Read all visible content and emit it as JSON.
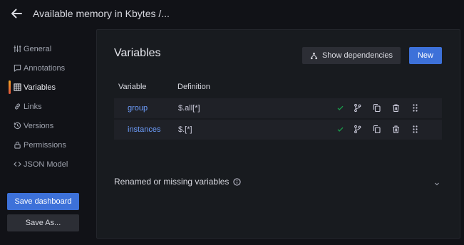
{
  "header": {
    "title": "Available memory in Kbytes /...",
    "back_icon": "arrow-left-icon"
  },
  "sidebar": {
    "items": [
      {
        "label": "General",
        "icon": "sliders-icon",
        "active": false
      },
      {
        "label": "Annotations",
        "icon": "comment-icon",
        "active": false
      },
      {
        "label": "Variables",
        "icon": "table-icon",
        "active": true
      },
      {
        "label": "Links",
        "icon": "link-icon",
        "active": false
      },
      {
        "label": "Versions",
        "icon": "history-icon",
        "active": false
      },
      {
        "label": "Permissions",
        "icon": "lock-icon",
        "active": false
      },
      {
        "label": "JSON Model",
        "icon": "code-icon",
        "active": false
      }
    ],
    "save_label": "Save dashboard",
    "save_as_label": "Save As..."
  },
  "main": {
    "title": "Variables",
    "show_dependencies_label": "Show dependencies",
    "new_label": "New",
    "columns": [
      "Variable",
      "Definition"
    ],
    "rows": [
      {
        "name": "group",
        "definition": "$.all[*]"
      },
      {
        "name": "instances",
        "definition": "$.[*]"
      }
    ],
    "renamed_label": "Renamed or missing variables"
  },
  "colors": {
    "primary": "#3d71d9",
    "link": "#6e9fff",
    "success": "#1a9e4b",
    "active_bar": "#f5a623"
  }
}
